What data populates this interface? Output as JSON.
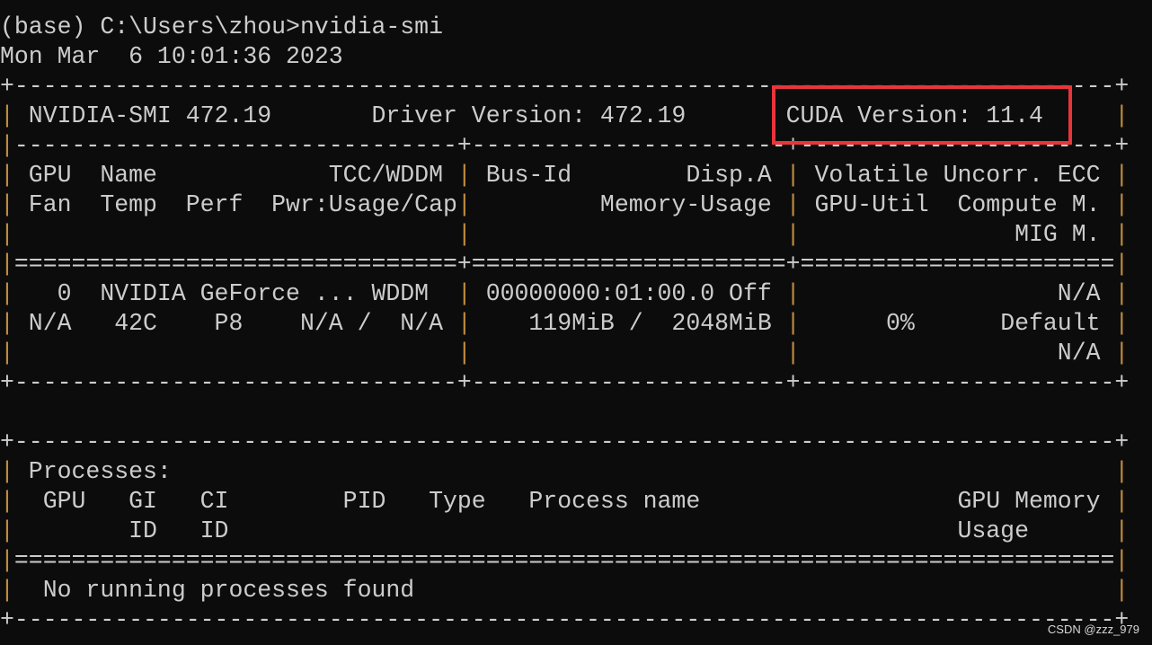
{
  "terminal": {
    "lines": [
      "(base) C:\\Users\\zhou>nvidia-smi",
      "Mon Mar  6 10:01:36 2023",
      "+-----------------------------------------------------------------------------+",
      "| NVIDIA-SMI 472.19       Driver Version: 472.19       CUDA Version: 11.4     |",
      "|-------------------------------+----------------------+----------------------+",
      "| GPU  Name            TCC/WDDM | Bus-Id        Disp.A | Volatile Uncorr. ECC |",
      "| Fan  Temp  Perf  Pwr:Usage/Cap|         Memory-Usage | GPU-Util  Compute M. |",
      "|                               |                      |               MIG M. |",
      "|===============================+======================+======================|",
      "|   0  NVIDIA GeForce ... WDDM  | 00000000:01:00.0 Off |                  N/A |",
      "| N/A   42C    P8    N/A /  N/A |    119MiB /  2048MiB |      0%      Default |",
      "|                               |                      |                  N/A |",
      "+-------------------------------+----------------------+----------------------+",
      "",
      "+-----------------------------------------------------------------------------+",
      "| Processes:                                                                  |",
      "|  GPU   GI   CI        PID   Type   Process name                  GPU Memory |",
      "|        ID   ID                                                   Usage      |",
      "|=============================================================================|",
      "|  No running processes found                                                 |",
      "+-----------------------------------------------------------------------------+"
    ]
  },
  "highlight": {
    "target": "CUDA Version: 11.4",
    "color": "#e8353a"
  },
  "watermark": "CSDN @zzz_979",
  "colors": {
    "background": "#0c0c0c",
    "text": "#cccccc",
    "border_pipe": "#c08a3e"
  }
}
